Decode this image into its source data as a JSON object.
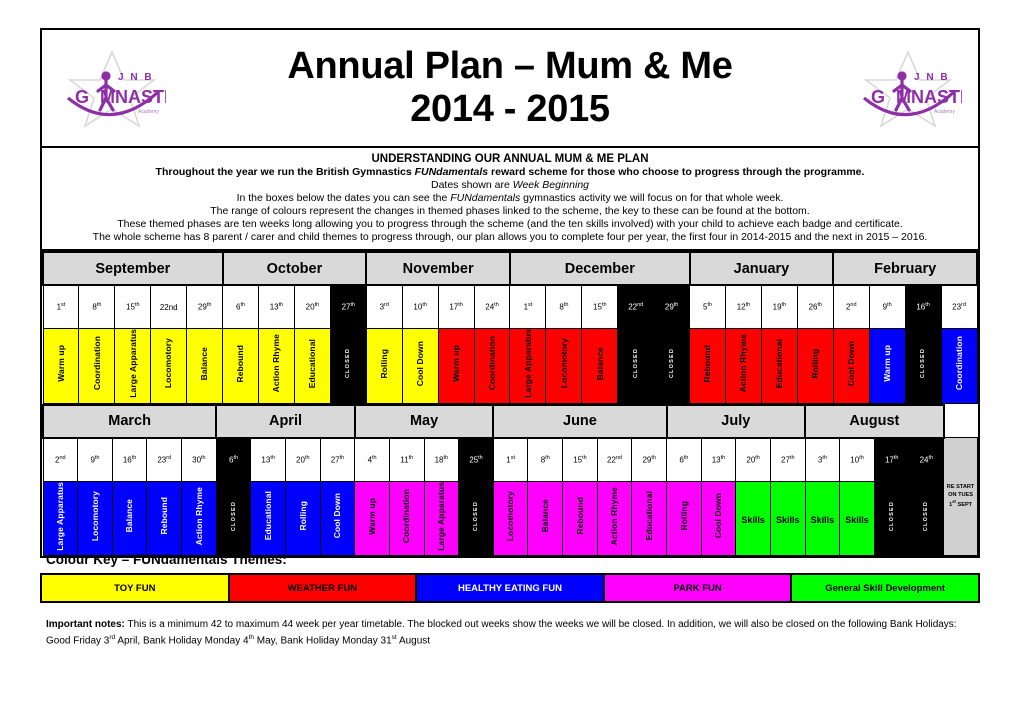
{
  "title": {
    "line1": "Annual Plan – Mum & Me",
    "line2": "2014 - 2015",
    "logo_alt": "JNB Gymnastics",
    "logo_top": "J N B",
    "logo_main": "GYMNASTICS",
    "logo_sub": "Academy"
  },
  "intro": {
    "heading": "UNDERSTANDING OUR ANNUAL MUM & ME PLAN",
    "l1_a": "Throughout the year we run the British Gymnastics ",
    "l1_i": "FUNdamentals",
    "l1_b": " reward scheme for those who choose to progress through the programme.",
    "l2_a": "Dates shown are ",
    "l2_i": "Week Beginning",
    "l3_a": "In the boxes below the dates you can see the ",
    "l3_i": "FUNdamentals",
    "l3_b": " gymnastics activity we will focus on for that whole week.",
    "l4": "The range of colours represent the changes in themed phases linked to the scheme, the key to these can be found at the bottom.",
    "l5": "These themed phases are ten weeks long allowing you to progress through the scheme (and the ten skills involved) with your child to achieve each badge and certificate.",
    "l6": "The whole scheme has 8 parent / carer and child themes to progress through, our plan allows you to complete four per year, the first four in 2014-2015 and the next in 2015 – 2016."
  },
  "colors": {
    "toy_fun": "#FFFF00",
    "weather_fun": "#FF0000",
    "healthy_eating_fun": "#0000FF",
    "park_fun": "#FF00FF",
    "general_skill": "#00FF00",
    "closed": "#000000",
    "month_header": "#D9D9D9",
    "restart": "#D0D0D0"
  },
  "closed_label": "CLOSED",
  "row1": {
    "months": [
      {
        "name": "September",
        "weeks": 5
      },
      {
        "name": "October",
        "weeks": 4
      },
      {
        "name": "November",
        "weeks": 4
      },
      {
        "name": "December",
        "weeks": 5
      },
      {
        "name": "January",
        "weeks": 4
      },
      {
        "name": "February",
        "weeks": 4
      }
    ],
    "weeks": [
      {
        "day": "1",
        "sup": "st",
        "closed": false
      },
      {
        "day": "8",
        "sup": "th",
        "closed": false
      },
      {
        "day": "15",
        "sup": "th",
        "closed": false
      },
      {
        "day": "22nd",
        "sup": "",
        "closed": false
      },
      {
        "day": "29",
        "sup": "th",
        "closed": false
      },
      {
        "day": "6",
        "sup": "th",
        "closed": false
      },
      {
        "day": "13",
        "sup": "th",
        "closed": false
      },
      {
        "day": "20",
        "sup": "th",
        "closed": false
      },
      {
        "day": "27",
        "sup": "th",
        "closed": true
      },
      {
        "day": "3",
        "sup": "rd",
        "closed": false
      },
      {
        "day": "10",
        "sup": "th",
        "closed": false
      },
      {
        "day": "17",
        "sup": "th",
        "closed": false
      },
      {
        "day": "24",
        "sup": "th",
        "closed": false
      },
      {
        "day": "1",
        "sup": "st",
        "closed": false
      },
      {
        "day": "8",
        "sup": "th",
        "closed": false
      },
      {
        "day": "15",
        "sup": "th",
        "closed": false
      },
      {
        "day": "22",
        "sup": "nd",
        "closed": true
      },
      {
        "day": "29",
        "sup": "th",
        "closed": true
      },
      {
        "day": "5",
        "sup": "th",
        "closed": false
      },
      {
        "day": "12",
        "sup": "th",
        "closed": false
      },
      {
        "day": "19",
        "sup": "th",
        "closed": false
      },
      {
        "day": "26",
        "sup": "th",
        "closed": false
      },
      {
        "day": "2",
        "sup": "nd",
        "closed": false
      },
      {
        "day": "9",
        "sup": "th",
        "closed": false
      },
      {
        "day": "16",
        "sup": "th",
        "closed": true
      },
      {
        "day": "23",
        "sup": "rd",
        "closed": false
      }
    ],
    "activities": [
      {
        "label": "Warm up",
        "theme": "toy_fun"
      },
      {
        "label": "Coordination",
        "theme": "toy_fun"
      },
      {
        "label": "Large Apparatus",
        "theme": "toy_fun"
      },
      {
        "label": "Locomotory",
        "theme": "toy_fun"
      },
      {
        "label": "Balance",
        "theme": "toy_fun"
      },
      {
        "label": "Rebound",
        "theme": "toy_fun"
      },
      {
        "label": "Action Rhyme",
        "theme": "toy_fun"
      },
      {
        "label": "Educational",
        "theme": "toy_fun"
      },
      {
        "label": "CLOSED",
        "theme": "closed"
      },
      {
        "label": "Rolling",
        "theme": "toy_fun"
      },
      {
        "label": "Cool Down",
        "theme": "toy_fun"
      },
      {
        "label": "Warm up",
        "theme": "weather_fun"
      },
      {
        "label": "Coordination",
        "theme": "weather_fun"
      },
      {
        "label": "Large Apparatus",
        "theme": "weather_fun"
      },
      {
        "label": "Locomotory",
        "theme": "weather_fun"
      },
      {
        "label": "Balance",
        "theme": "weather_fun"
      },
      {
        "label": "CLOSED",
        "theme": "closed"
      },
      {
        "label": "CLOSED",
        "theme": "closed"
      },
      {
        "label": "Rebound",
        "theme": "weather_fun"
      },
      {
        "label": "Action Rhyme",
        "theme": "weather_fun"
      },
      {
        "label": "Educational",
        "theme": "weather_fun"
      },
      {
        "label": "Rolling",
        "theme": "weather_fun"
      },
      {
        "label": "Cool Down",
        "theme": "weather_fun"
      },
      {
        "label": "Warm up",
        "theme": "healthy_eating_fun"
      },
      {
        "label": "CLOSED",
        "theme": "closed"
      },
      {
        "label": "Coordination",
        "theme": "healthy_eating_fun"
      }
    ]
  },
  "row2": {
    "months": [
      {
        "name": "March",
        "weeks": 5
      },
      {
        "name": "April",
        "weeks": 4
      },
      {
        "name": "May",
        "weeks": 4
      },
      {
        "name": "June",
        "weeks": 5
      },
      {
        "name": "July",
        "weeks": 4
      },
      {
        "name": "August",
        "weeks": 4
      }
    ],
    "weeks": [
      {
        "day": "2",
        "sup": "nd",
        "closed": false
      },
      {
        "day": "9",
        "sup": "th",
        "closed": false
      },
      {
        "day": "16",
        "sup": "th",
        "closed": false
      },
      {
        "day": "23",
        "sup": "rd",
        "closed": false
      },
      {
        "day": "30",
        "sup": "th",
        "closed": false
      },
      {
        "day": "6",
        "sup": "th",
        "closed": true
      },
      {
        "day": "13",
        "sup": "th",
        "closed": false
      },
      {
        "day": "20",
        "sup": "th",
        "closed": false
      },
      {
        "day": "27",
        "sup": "th",
        "closed": false
      },
      {
        "day": "4",
        "sup": "th",
        "closed": false
      },
      {
        "day": "11",
        "sup": "th",
        "closed": false
      },
      {
        "day": "18",
        "sup": "th",
        "closed": false
      },
      {
        "day": "25",
        "sup": "th",
        "closed": true
      },
      {
        "day": "1",
        "sup": "st",
        "closed": false
      },
      {
        "day": "8",
        "sup": "th",
        "closed": false
      },
      {
        "day": "15",
        "sup": "th",
        "closed": false
      },
      {
        "day": "22",
        "sup": "nd",
        "closed": false
      },
      {
        "day": "29",
        "sup": "th",
        "closed": false
      },
      {
        "day": "6",
        "sup": "th",
        "closed": false
      },
      {
        "day": "13",
        "sup": "th",
        "closed": false
      },
      {
        "day": "20",
        "sup": "th",
        "closed": false
      },
      {
        "day": "27",
        "sup": "th",
        "closed": false
      },
      {
        "day": "3",
        "sup": "th",
        "closed": false
      },
      {
        "day": "10",
        "sup": "th",
        "closed": false
      },
      {
        "day": "17",
        "sup": "th",
        "closed": true
      },
      {
        "day": "24",
        "sup": "th",
        "closed": true
      }
    ],
    "activities": [
      {
        "label": "Large Apparatus",
        "theme": "healthy_eating_fun"
      },
      {
        "label": "Locomotory",
        "theme": "healthy_eating_fun"
      },
      {
        "label": "Balance",
        "theme": "healthy_eating_fun"
      },
      {
        "label": "Rebound",
        "theme": "healthy_eating_fun"
      },
      {
        "label": "Action Rhyme",
        "theme": "healthy_eating_fun"
      },
      {
        "label": "CLOSED",
        "theme": "closed"
      },
      {
        "label": "Educational",
        "theme": "healthy_eating_fun"
      },
      {
        "label": "Rolling",
        "theme": "healthy_eating_fun"
      },
      {
        "label": "Cool Down",
        "theme": "healthy_eating_fun"
      },
      {
        "label": "Warm up",
        "theme": "park_fun"
      },
      {
        "label": "Coordination",
        "theme": "park_fun"
      },
      {
        "label": "Large Apparatus",
        "theme": "park_fun"
      },
      {
        "label": "CLOSED",
        "theme": "closed"
      },
      {
        "label": "Locomotory",
        "theme": "park_fun"
      },
      {
        "label": "Balance",
        "theme": "park_fun"
      },
      {
        "label": "Rebound",
        "theme": "park_fun"
      },
      {
        "label": "Action Rhyme",
        "theme": "park_fun"
      },
      {
        "label": "Educational",
        "theme": "park_fun"
      },
      {
        "label": "Rolling",
        "theme": "park_fun"
      },
      {
        "label": "Cool Down",
        "theme": "park_fun"
      },
      {
        "label": "Skills",
        "theme": "general_skill",
        "horizontal": true
      },
      {
        "label": "Skills",
        "theme": "general_skill",
        "horizontal": true
      },
      {
        "label": "Skills",
        "theme": "general_skill",
        "horizontal": true
      },
      {
        "label": "Skills",
        "theme": "general_skill",
        "horizontal": true
      },
      {
        "label": "CLOSED",
        "theme": "closed"
      },
      {
        "label": "CLOSED",
        "theme": "closed"
      }
    ],
    "restart": {
      "l1": "RE START",
      "l2": "ON TUES",
      "l3_num": "1",
      "l3_sup": "st",
      "l3_rest": " SEPT"
    }
  },
  "key": {
    "title": "Colour Key – FUNdamentals Themes:",
    "items": [
      {
        "label": "TOY FUN",
        "theme": "toy_fun",
        "text_color": "#000000"
      },
      {
        "label": "WEATHER FUN",
        "theme": "weather_fun",
        "text_color": "#000000"
      },
      {
        "label": "HEALTHY EATING FUN",
        "theme": "healthy_eating_fun",
        "text_color": "#FFFFFF"
      },
      {
        "label": "PARK FUN",
        "theme": "park_fun",
        "text_color": "#000000"
      },
      {
        "label": "General Skill Development",
        "theme": "general_skill",
        "text_color": "#000000"
      }
    ]
  },
  "notes": {
    "label": "Important notes:",
    "t1": " This is a minimum 42 to maximum 44 week per year timetable. The blocked out weeks show the weeks we will be closed. In addition, we will also be closed on the following Bank Holidays: Good Friday 3",
    "s1": "rd",
    "t2": " April, Bank Holiday Monday 4",
    "s2": "th",
    "t3": " May, Bank Holiday Monday 31",
    "s3": "st",
    "t4": " August"
  }
}
